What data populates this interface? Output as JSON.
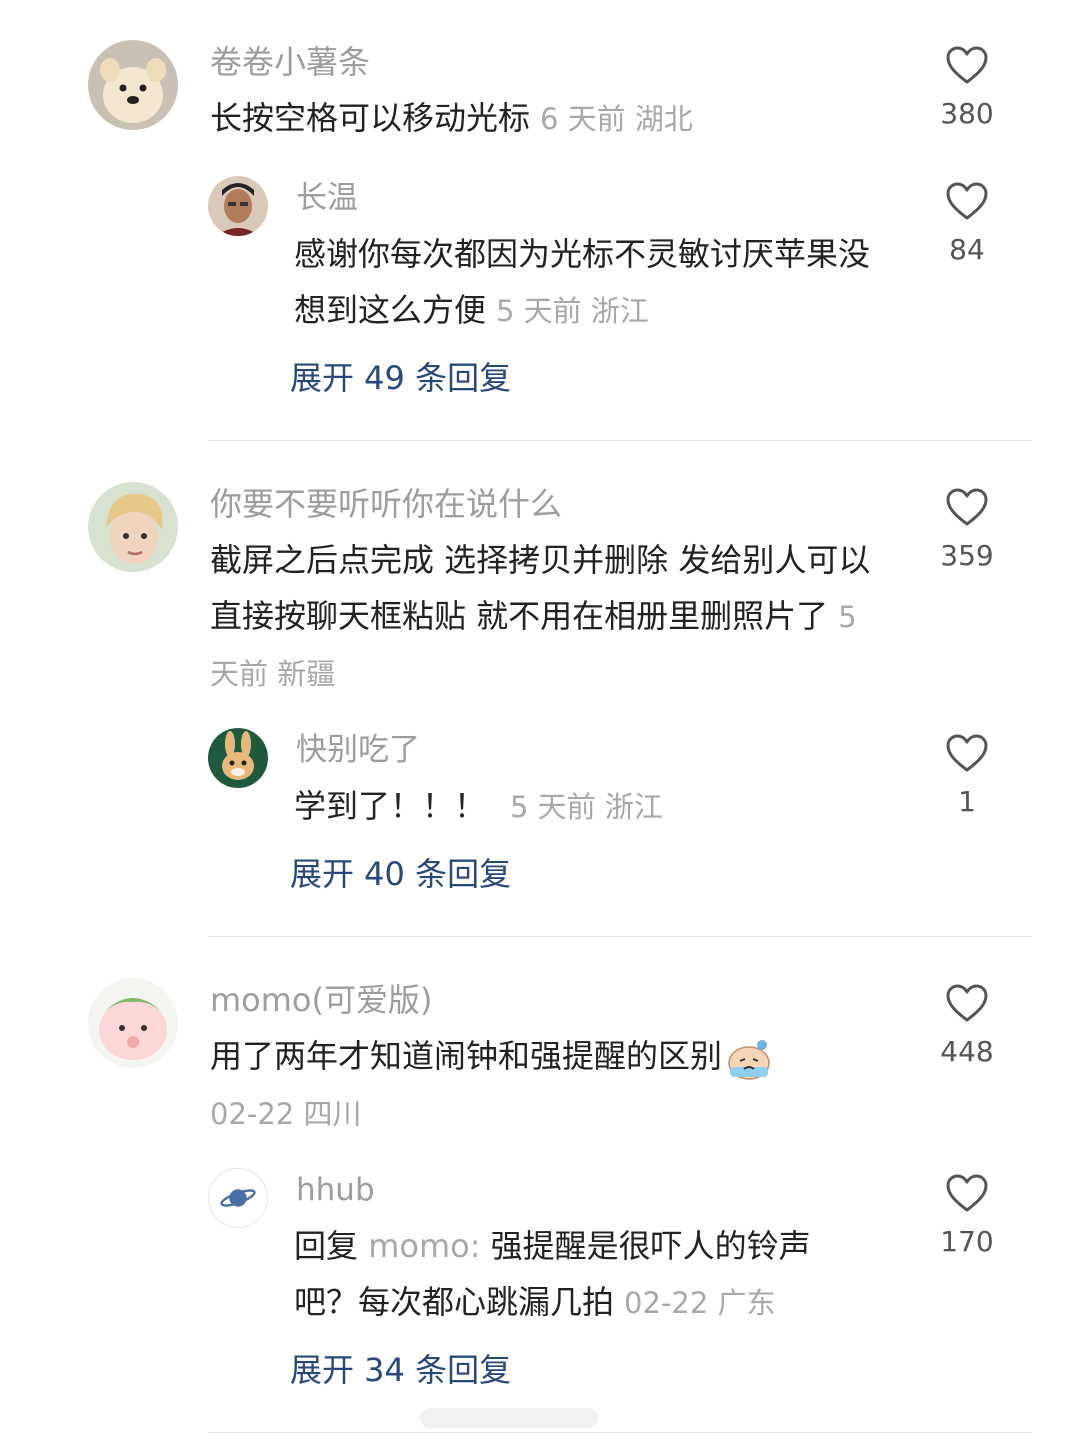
{
  "threads": [
    {
      "comment": {
        "username": "卷卷小薯条",
        "text": "长按空格可以移动光标",
        "meta": "6 天前 湖北",
        "likes": "380",
        "avatar": "dog-avatar"
      },
      "reply": {
        "username": "长温",
        "text": "感谢你每次都因为光标不灵敏讨厌苹果没想到这么方便",
        "meta": "5 天前 浙江",
        "likes": "84",
        "avatar": "man-avatar"
      },
      "expand_label": "展开 49 条回复"
    },
    {
      "comment": {
        "username": "你要不要听听你在说什么",
        "text": "截屏之后点完成 选择拷贝并删除 发给别人可以直接按聊天框粘贴 就不用在相册里删照片了",
        "meta": "5 天前 新疆",
        "likes": "359",
        "avatar": "blonde-person-avatar"
      },
      "reply": {
        "username": "快别吃了",
        "text": "学到了！！！",
        "meta": "5 天前 浙江",
        "likes": "1",
        "avatar": "bunny-avatar"
      },
      "expand_label": "展开 40 条回复"
    },
    {
      "comment": {
        "username": "momo(可爱版)",
        "text": "用了两年才知道闹钟和强提醒的区别",
        "meta": "02-22 四川",
        "likes": "448",
        "avatar": "peach-avatar"
      },
      "reply": {
        "username": "hhub",
        "prefix": "回复",
        "mention": "momo:",
        "text": "强提醒是很吓人的铃声吧？每次都心跳漏几拍",
        "meta": "02-22 广东",
        "likes": "170",
        "avatar": "planet-avatar"
      },
      "expand_label": "展开 34 条回复"
    }
  ],
  "icons": {
    "like": "heart-outline-icon",
    "emoji": "crying-emoji-icon"
  },
  "colors": {
    "username": "#9d9d9d",
    "meta": "#a8a8a8",
    "expand": "#27497e",
    "body_text": "#222222"
  }
}
